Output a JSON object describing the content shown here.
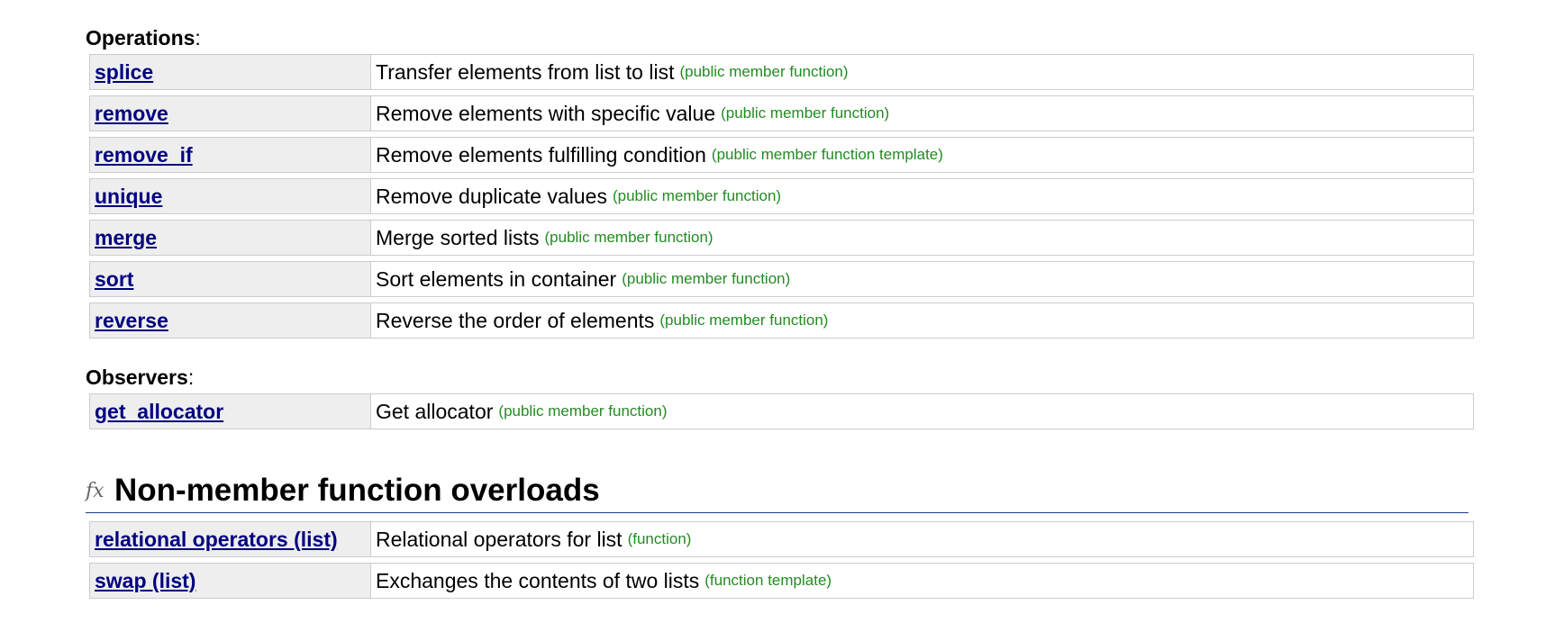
{
  "operations": {
    "label": "Operations",
    "items": [
      {
        "name": "splice",
        "desc": "Transfer elements from list to list",
        "kind": "(public member function)"
      },
      {
        "name": "remove",
        "desc": "Remove elements with specific value",
        "kind": "(public member function)"
      },
      {
        "name": "remove_if",
        "desc": "Remove elements fulfilling condition",
        "kind": "(public member function template)"
      },
      {
        "name": "unique",
        "desc": "Remove duplicate values",
        "kind": "(public member function)"
      },
      {
        "name": "merge",
        "desc": "Merge sorted lists",
        "kind": "(public member function)"
      },
      {
        "name": "sort",
        "desc": "Sort elements in container",
        "kind": "(public member function)"
      },
      {
        "name": "reverse",
        "desc": "Reverse the order of elements",
        "kind": "(public member function)"
      }
    ]
  },
  "observers": {
    "label": "Observers",
    "items": [
      {
        "name": "get_allocator",
        "desc": "Get allocator",
        "kind": "(public member function)"
      }
    ]
  },
  "nonmember": {
    "icon": "fx-icon",
    "title": "Non-member function overloads",
    "items": [
      {
        "name": "relational operators (list)",
        "desc": "Relational operators for list",
        "kind": "(function)"
      },
      {
        "name": "swap (list)",
        "desc": "Exchanges the contents of two lists",
        "kind": "(function template)"
      }
    ]
  },
  "colors": {
    "link": "#00007f",
    "kind": "#228b22",
    "name_cell_bg": "#eeeeee",
    "border": "#cccccc",
    "heading_rule": "#1a3a8c"
  }
}
